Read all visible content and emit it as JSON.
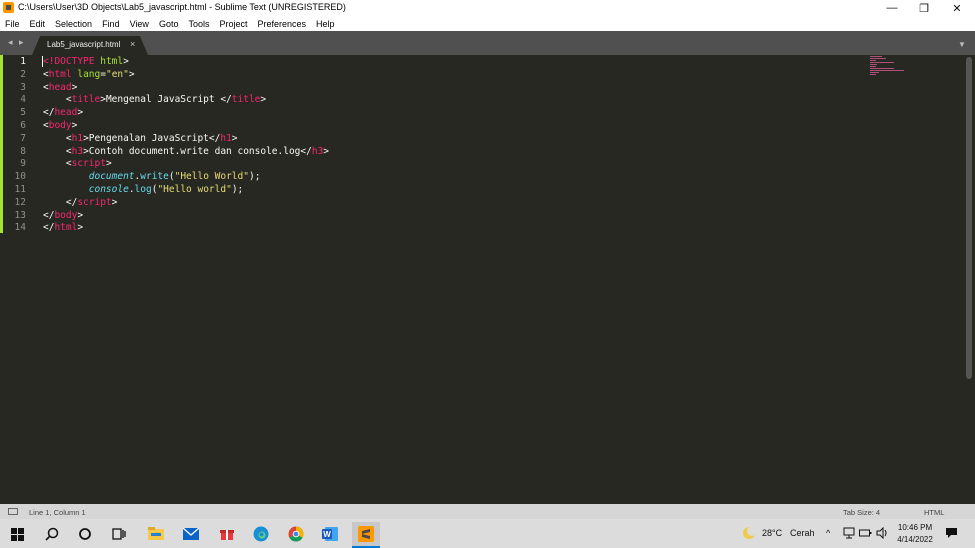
{
  "window": {
    "title": "C:\\Users\\User\\3D Objects\\Lab5_javascript.html - Sublime Text (UNREGISTERED)",
    "controls": {
      "minimize": "—",
      "maximize": "❐",
      "close": "✕"
    }
  },
  "menu": [
    "File",
    "Edit",
    "Selection",
    "Find",
    "View",
    "Goto",
    "Tools",
    "Project",
    "Preferences",
    "Help"
  ],
  "tabs": {
    "nav": "◂ ▸",
    "active": {
      "label": "Lab5_javascript.html",
      "close": "×"
    },
    "dropdown": "▼"
  },
  "editor": {
    "line_numbers": [
      "1",
      "2",
      "3",
      "4",
      "5",
      "6",
      "7",
      "8",
      "9",
      "10",
      "11",
      "12",
      "13",
      "14"
    ],
    "active_line": 1,
    "lines": [
      [
        [
          "t",
          "<"
        ],
        [
          "t",
          "!DOCTYPE "
        ],
        [
          "a",
          "html"
        ],
        [
          "p",
          ">"
        ]
      ],
      [
        [
          "p",
          "<"
        ],
        [
          "t",
          "html "
        ],
        [
          "a",
          "lang"
        ],
        [
          "p",
          "="
        ],
        [
          "s",
          "\"en\""
        ],
        [
          "p",
          ">"
        ]
      ],
      [
        [
          "p",
          "<"
        ],
        [
          "t",
          "head"
        ],
        [
          "p",
          ">"
        ]
      ],
      [
        [
          "p",
          "    <"
        ],
        [
          "t",
          "title"
        ],
        [
          "p",
          ">Mengenal JavaScript </"
        ],
        [
          "t",
          "title"
        ],
        [
          "p",
          ">"
        ]
      ],
      [
        [
          "p",
          "</"
        ],
        [
          "t",
          "head"
        ],
        [
          "p",
          ">"
        ]
      ],
      [
        [
          "p",
          "<"
        ],
        [
          "t",
          "body"
        ],
        [
          "p",
          ">"
        ]
      ],
      [
        [
          "p",
          "    <"
        ],
        [
          "t",
          "h1"
        ],
        [
          "p",
          ">Pengenalan JavaScript</"
        ],
        [
          "t",
          "h1"
        ],
        [
          "p",
          ">"
        ]
      ],
      [
        [
          "p",
          "    <"
        ],
        [
          "t",
          "h3"
        ],
        [
          "p",
          ">Contoh document.write dan console.log</"
        ],
        [
          "t",
          "h3"
        ],
        [
          "p",
          ">"
        ]
      ],
      [
        [
          "p",
          "    <"
        ],
        [
          "t",
          "script"
        ],
        [
          "p",
          ">"
        ]
      ],
      [
        [
          "p",
          "        "
        ],
        [
          "f",
          "document"
        ],
        [
          "p",
          "."
        ],
        [
          "fn",
          "write"
        ],
        [
          "p",
          "("
        ],
        [
          "s",
          "\"Hello World\""
        ],
        [
          "p",
          ");"
        ]
      ],
      [
        [
          "p",
          "        "
        ],
        [
          "f",
          "console"
        ],
        [
          "p",
          "."
        ],
        [
          "fn",
          "log"
        ],
        [
          "p",
          "("
        ],
        [
          "s",
          "\"Hello world\""
        ],
        [
          "p",
          ");"
        ]
      ],
      [
        [
          "p",
          "    </"
        ],
        [
          "t",
          "script"
        ],
        [
          "p",
          ">"
        ]
      ],
      [
        [
          "p",
          "</"
        ],
        [
          "t",
          "body"
        ],
        [
          "p",
          ">"
        ]
      ],
      [
        [
          "p",
          "</"
        ],
        [
          "t",
          "html"
        ],
        [
          "p",
          ">"
        ]
      ]
    ],
    "colors": {
      "background": "#272822",
      "tag": "#f92672",
      "attr": "#a6e22e",
      "string": "#e6db74",
      "builtin": "#66d9ef",
      "text": "#f8f8f2"
    }
  },
  "status": {
    "position": "Line 1, Column 1",
    "tab_size": "Tab Size: 4",
    "syntax": "HTML"
  },
  "taskbar": {
    "icons": [
      "windows-start-icon",
      "search-icon",
      "cortana-icon",
      "task-view-icon",
      "file-explorer-icon",
      "mail-icon",
      "gift-icon",
      "edge-icon",
      "chrome-icon",
      "word-icon",
      "sublime-text-icon"
    ],
    "weather": {
      "temperature": "28°C",
      "condition": "Cerah"
    },
    "tray_chevron": "^",
    "clock": {
      "time": "10:46 PM",
      "date": "4/14/2022"
    }
  }
}
